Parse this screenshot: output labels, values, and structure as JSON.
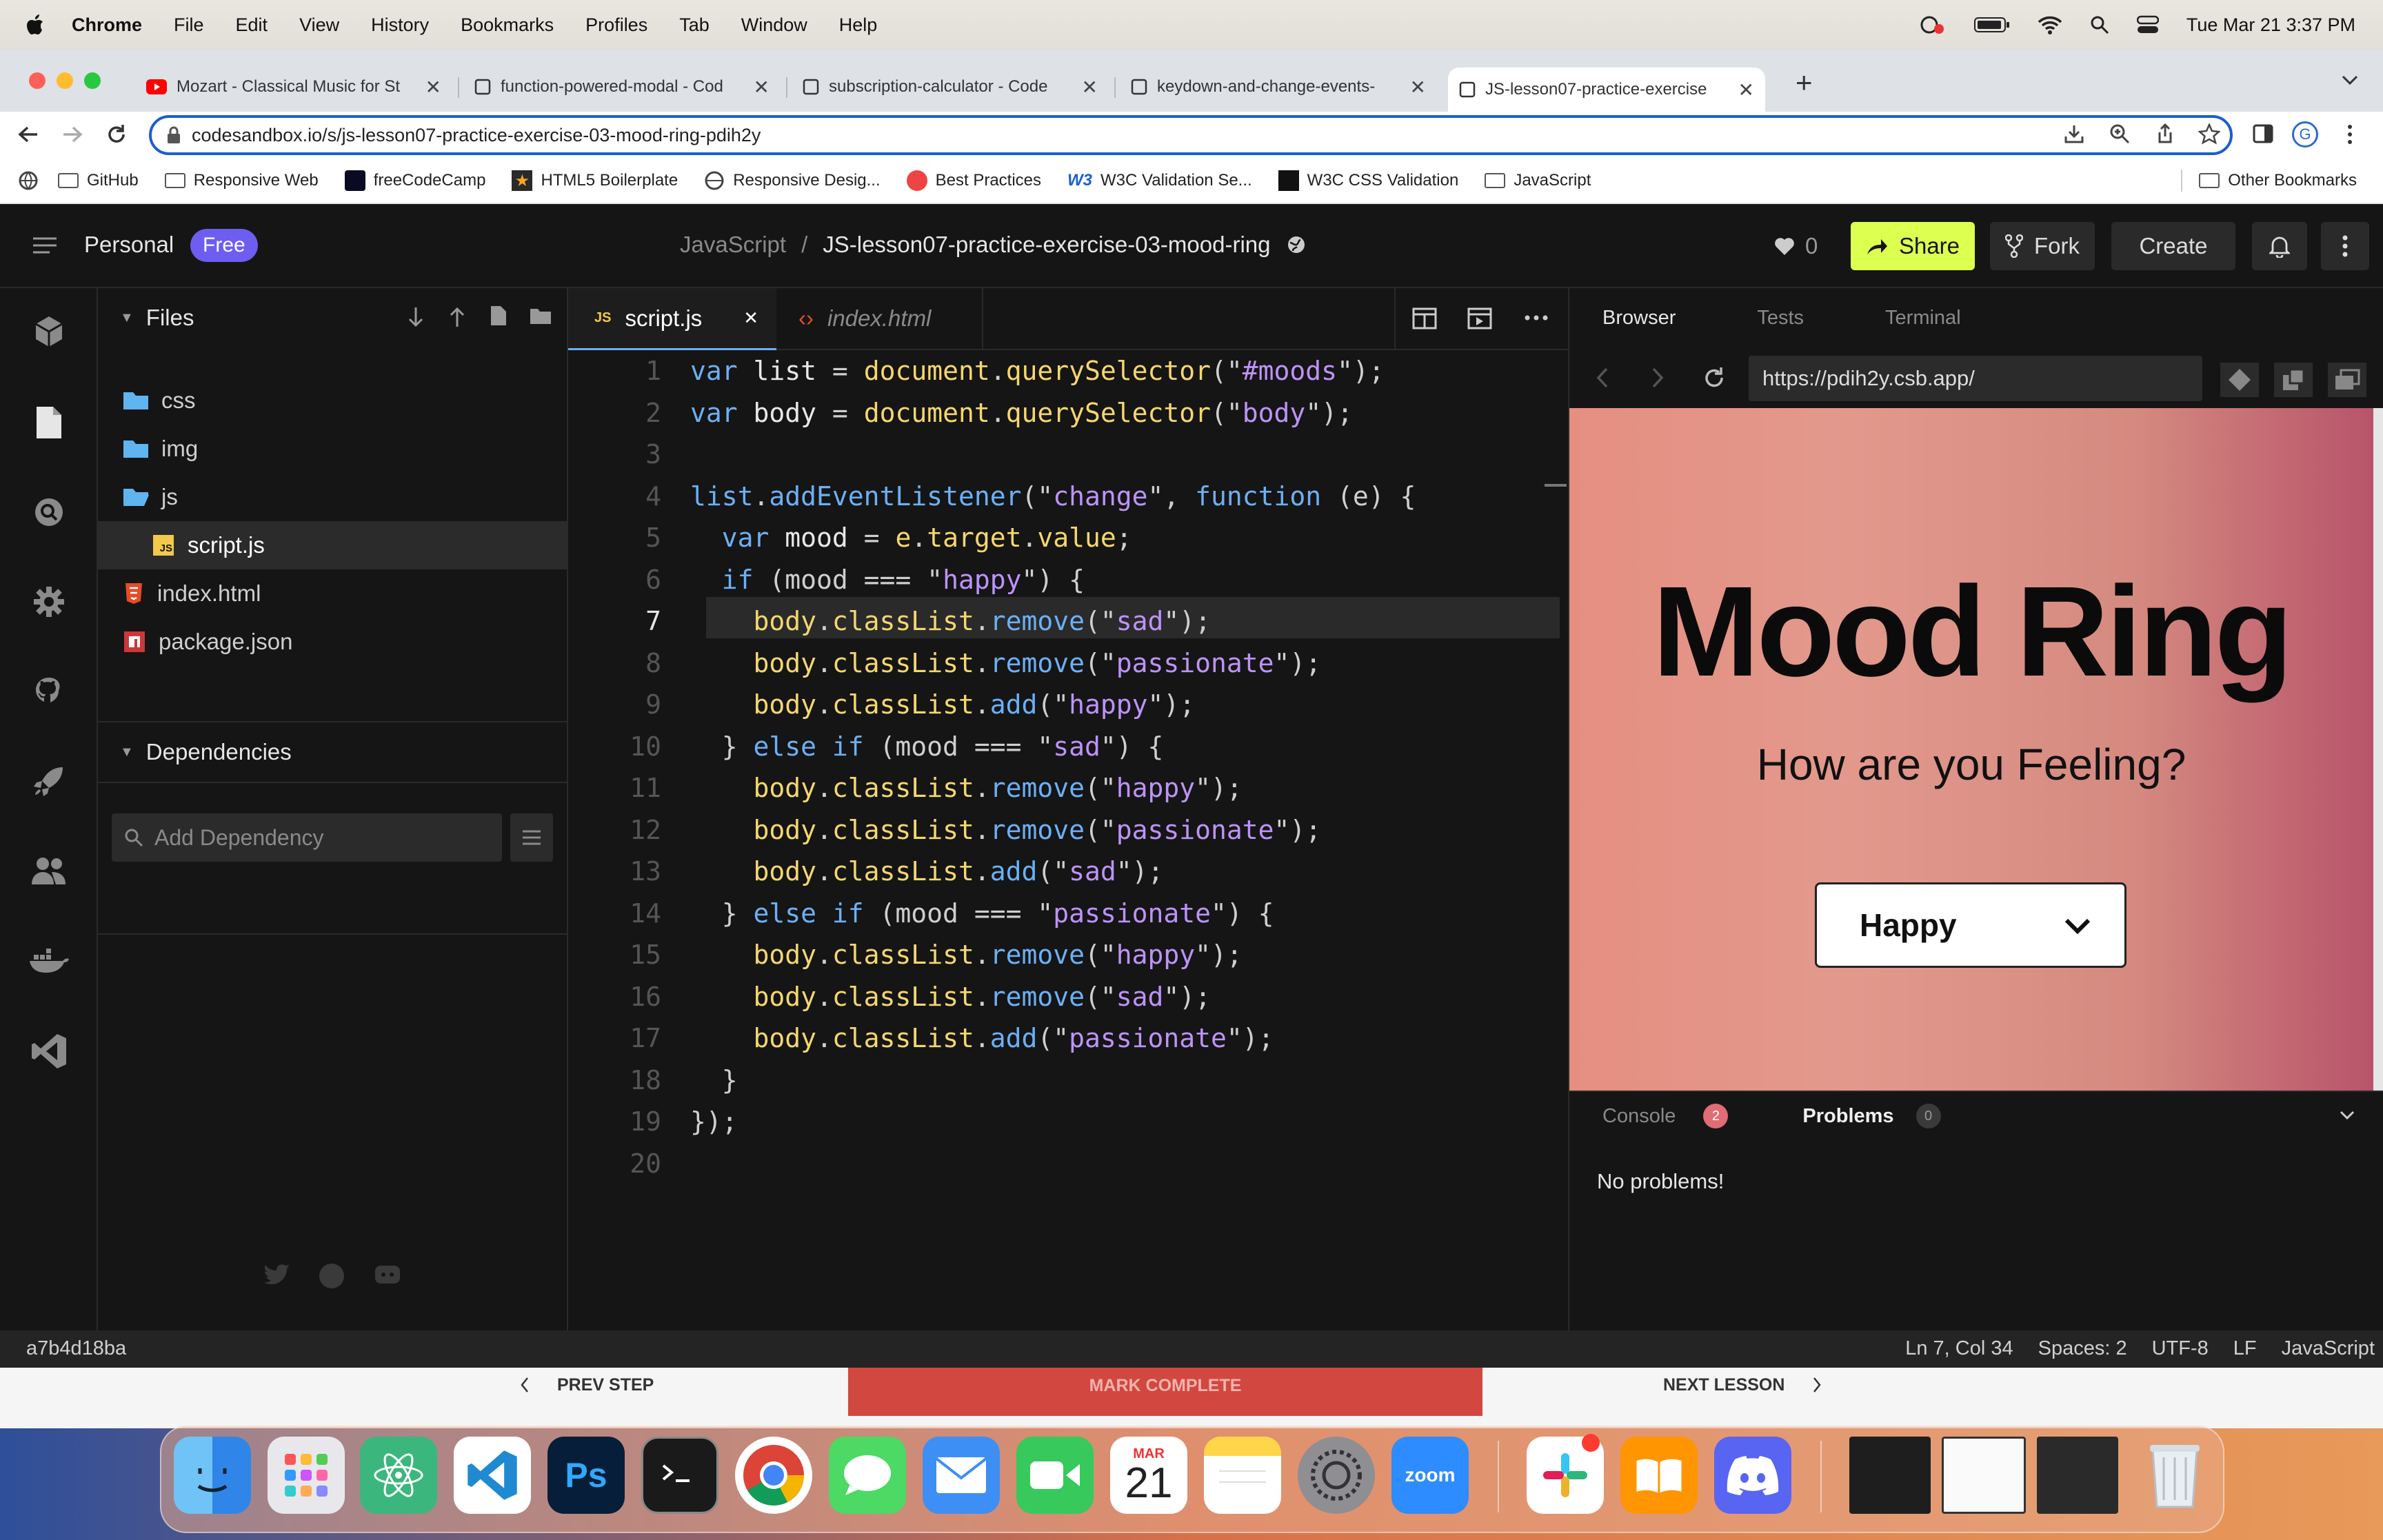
{
  "menubar": {
    "app": "Chrome",
    "items": [
      "File",
      "Edit",
      "View",
      "History",
      "Bookmarks",
      "Profiles",
      "Tab",
      "Window",
      "Help"
    ],
    "datetime": "Tue Mar 21  3:37 PM"
  },
  "tabs": [
    {
      "title": "Mozart - Classical Music for St"
    },
    {
      "title": "function-powered-modal - Cod"
    },
    {
      "title": "subscription-calculator - Code"
    },
    {
      "title": "keydown-and-change-events-"
    },
    {
      "title": "JS-lesson07-practice-exercise"
    }
  ],
  "address": {
    "url": "codesandbox.io/s/js-lesson07-practice-exercise-03-mood-ring-pdih2y"
  },
  "profile_initial": "G",
  "bookmarks": [
    "GitHub",
    "Responsive Web",
    "freeCodeCamp",
    "HTML5 Boilerplate",
    "Responsive Desig...",
    "Best Practices",
    "W3C Validation Se...",
    "W3C CSS Validation",
    "JavaScript"
  ],
  "other_bookmarks": "Other Bookmarks",
  "csb": {
    "workspace": "Personal",
    "plan": "Free",
    "crumb_parent": "JavaScript",
    "crumb_sep": "/",
    "project": "JS-lesson07-practice-exercise-03-mood-ring",
    "likes": "0",
    "share": "Share",
    "fork": "Fork",
    "create": "Create",
    "files_title": "Files",
    "tree": [
      "css",
      "img",
      "js",
      "script.js",
      "index.html",
      "package.json"
    ],
    "deps_title": "Dependencies",
    "dep_placeholder": "Add Dependency",
    "tab_active": "script.js",
    "tab_other": "index.html",
    "js_badge": "JS"
  },
  "code": [
    {
      "n": "1",
      "t": [
        [
          "k",
          "var"
        ],
        [
          "i",
          " list "
        ],
        [
          "p",
          "= "
        ],
        [
          "y",
          "document"
        ],
        [
          "p",
          "."
        ],
        [
          "y",
          "querySelector"
        ],
        [
          "p",
          "(\""
        ],
        [
          "s",
          "#moods"
        ],
        [
          "p",
          "\");"
        ]
      ]
    },
    {
      "n": "2",
      "t": [
        [
          "k",
          "var"
        ],
        [
          "i",
          " body "
        ],
        [
          "p",
          "= "
        ],
        [
          "y",
          "document"
        ],
        [
          "p",
          "."
        ],
        [
          "y",
          "querySelector"
        ],
        [
          "p",
          "(\""
        ],
        [
          "s",
          "body"
        ],
        [
          "p",
          "\");"
        ]
      ]
    },
    {
      "n": "3",
      "t": []
    },
    {
      "n": "4",
      "t": [
        [
          "k",
          "list"
        ],
        [
          "p",
          "."
        ],
        [
          "k",
          "addEventListener"
        ],
        [
          "p",
          "(\""
        ],
        [
          "s",
          "change"
        ],
        [
          "p",
          "\", "
        ],
        [
          "k",
          "function"
        ],
        [
          "p",
          " (e) {"
        ]
      ]
    },
    {
      "n": "5",
      "t": [
        [
          "p",
          "  "
        ],
        [
          "k",
          "var"
        ],
        [
          "i",
          " mood "
        ],
        [
          "p",
          "= "
        ],
        [
          "y",
          "e"
        ],
        [
          "p",
          "."
        ],
        [
          "y",
          "target"
        ],
        [
          "p",
          "."
        ],
        [
          "y",
          "value"
        ],
        [
          "p",
          ";"
        ]
      ]
    },
    {
      "n": "6",
      "t": [
        [
          "p",
          "  "
        ],
        [
          "k",
          "if"
        ],
        [
          "p",
          " (mood === \""
        ],
        [
          "s",
          "happy"
        ],
        [
          "p",
          "\") {"
        ]
      ]
    },
    {
      "n": "7",
      "t": [
        [
          "p",
          "    "
        ],
        [
          "y",
          "body"
        ],
        [
          "p",
          "."
        ],
        [
          "y",
          "classList"
        ],
        [
          "p",
          "."
        ],
        [
          "k",
          "remove"
        ],
        [
          "p",
          "(\""
        ],
        [
          "s",
          "sad"
        ],
        [
          "p",
          "\");"
        ]
      ]
    },
    {
      "n": "8",
      "t": [
        [
          "p",
          "    "
        ],
        [
          "y",
          "body"
        ],
        [
          "p",
          "."
        ],
        [
          "y",
          "classList"
        ],
        [
          "p",
          "."
        ],
        [
          "k",
          "remove"
        ],
        [
          "p",
          "(\""
        ],
        [
          "s",
          "passionate"
        ],
        [
          "p",
          "\");"
        ]
      ]
    },
    {
      "n": "9",
      "t": [
        [
          "p",
          "    "
        ],
        [
          "y",
          "body"
        ],
        [
          "p",
          "."
        ],
        [
          "y",
          "classList"
        ],
        [
          "p",
          "."
        ],
        [
          "k",
          "add"
        ],
        [
          "p",
          "(\""
        ],
        [
          "s",
          "happy"
        ],
        [
          "p",
          "\");"
        ]
      ]
    },
    {
      "n": "10",
      "t": [
        [
          "p",
          "  } "
        ],
        [
          "k",
          "else if"
        ],
        [
          "p",
          " (mood === \""
        ],
        [
          "s",
          "sad"
        ],
        [
          "p",
          "\") {"
        ]
      ]
    },
    {
      "n": "11",
      "t": [
        [
          "p",
          "    "
        ],
        [
          "y",
          "body"
        ],
        [
          "p",
          "."
        ],
        [
          "y",
          "classList"
        ],
        [
          "p",
          "."
        ],
        [
          "k",
          "remove"
        ],
        [
          "p",
          "(\""
        ],
        [
          "s",
          "happy"
        ],
        [
          "p",
          "\");"
        ]
      ]
    },
    {
      "n": "12",
      "t": [
        [
          "p",
          "    "
        ],
        [
          "y",
          "body"
        ],
        [
          "p",
          "."
        ],
        [
          "y",
          "classList"
        ],
        [
          "p",
          "."
        ],
        [
          "k",
          "remove"
        ],
        [
          "p",
          "(\""
        ],
        [
          "s",
          "passionate"
        ],
        [
          "p",
          "\");"
        ]
      ]
    },
    {
      "n": "13",
      "t": [
        [
          "p",
          "    "
        ],
        [
          "y",
          "body"
        ],
        [
          "p",
          "."
        ],
        [
          "y",
          "classList"
        ],
        [
          "p",
          "."
        ],
        [
          "k",
          "add"
        ],
        [
          "p",
          "(\""
        ],
        [
          "s",
          "sad"
        ],
        [
          "p",
          "\");"
        ]
      ]
    },
    {
      "n": "14",
      "t": [
        [
          "p",
          "  } "
        ],
        [
          "k",
          "else if"
        ],
        [
          "p",
          " (mood === \""
        ],
        [
          "s",
          "passionate"
        ],
        [
          "p",
          "\") {"
        ]
      ]
    },
    {
      "n": "15",
      "t": [
        [
          "p",
          "    "
        ],
        [
          "y",
          "body"
        ],
        [
          "p",
          "."
        ],
        [
          "y",
          "classList"
        ],
        [
          "p",
          "."
        ],
        [
          "k",
          "remove"
        ],
        [
          "p",
          "(\""
        ],
        [
          "s",
          "happy"
        ],
        [
          "p",
          "\");"
        ]
      ]
    },
    {
      "n": "16",
      "t": [
        [
          "p",
          "    "
        ],
        [
          "y",
          "body"
        ],
        [
          "p",
          "."
        ],
        [
          "y",
          "classList"
        ],
        [
          "p",
          "."
        ],
        [
          "k",
          "remove"
        ],
        [
          "p",
          "(\""
        ],
        [
          "s",
          "sad"
        ],
        [
          "p",
          "\");"
        ]
      ]
    },
    {
      "n": "17",
      "t": [
        [
          "p",
          "    "
        ],
        [
          "y",
          "body"
        ],
        [
          "p",
          "."
        ],
        [
          "y",
          "classList"
        ],
        [
          "p",
          "."
        ],
        [
          "k",
          "add"
        ],
        [
          "p",
          "(\""
        ],
        [
          "s",
          "passionate"
        ],
        [
          "p",
          "\");"
        ]
      ]
    },
    {
      "n": "18",
      "t": [
        [
          "p",
          "  }"
        ]
      ]
    },
    {
      "n": "19",
      "t": [
        [
          "p",
          "});"
        ]
      ]
    },
    {
      "n": "20",
      "t": []
    }
  ],
  "preview": {
    "tabs": [
      "Browser",
      "Tests",
      "Terminal"
    ],
    "url": "https://pdih2y.csb.app/",
    "heading": "Mood Ring",
    "subheading": "How are you Feeling?",
    "select_value": "Happy",
    "console": "Console",
    "console_count": "2",
    "problems": "Problems",
    "problems_count": "0",
    "no_problems": "No problems!"
  },
  "status": {
    "commit": "a7b4d18ba",
    "position": "Ln 7, Col 34",
    "spaces": "Spaces: 2",
    "encoding": "UTF-8",
    "eol": "LF",
    "language": "JavaScript"
  },
  "lesson": {
    "prev": "PREV STEP",
    "complete": "MARK COMPLETE",
    "next": "NEXT LESSON"
  },
  "dock": {
    "calendar_month": "MAR",
    "calendar_day": "21",
    "zoom": "zoom",
    "ps": "Ps"
  },
  "colors": {
    "csb_bg": "#151515",
    "accent_share": "#dcff50",
    "free_badge": "#6d5df0",
    "preview_pink": "#e58e80",
    "complete_red": "#d2473f"
  }
}
